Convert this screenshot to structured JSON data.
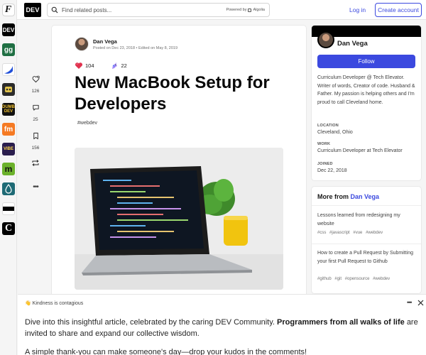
{
  "header": {
    "brand": "DEV",
    "search_placeholder": "Find related posts...",
    "powered_by": "Powered by",
    "powered_brand": "Algolia",
    "login_label": "Log in",
    "create_account_label": "Create account"
  },
  "rail": {
    "items": [
      {
        "name": "dev",
        "label": "DEV",
        "bg": "#000000"
      },
      {
        "name": "gg",
        "label": "gg",
        "bg": "#1f6f43"
      },
      {
        "name": "wave",
        "label": "",
        "bg": "#1f4ed8"
      },
      {
        "name": "robot",
        "label": "",
        "bg": "#2b2b2b"
      },
      {
        "name": "dumb-dev",
        "label": "DUMB DEV",
        "bg": "#111111"
      },
      {
        "name": "fm",
        "label": "fm",
        "bg": "#f57a23"
      },
      {
        "name": "vibe",
        "label": "VIBE",
        "bg": "#2a1d4d"
      },
      {
        "name": "m",
        "label": "m",
        "bg": "#6bb12b"
      },
      {
        "name": "drop",
        "label": "",
        "bg": "#1e6a75"
      },
      {
        "name": "bar",
        "label": "",
        "bg": "#ffffff"
      },
      {
        "name": "c",
        "label": "C",
        "bg": "#000000"
      }
    ]
  },
  "actions": {
    "likes": "126",
    "comments": "25",
    "saves": "156"
  },
  "article": {
    "author": "Dan Vega",
    "meta": "Posted on Dec 23, 2018 • Edited on May 8, 2019",
    "heart_count": "104",
    "unicorn_count": "22",
    "title": "New MacBook Setup for Developers",
    "tag": "#webdev"
  },
  "profile": {
    "name": "Dan Vega",
    "follow_label": "Follow",
    "bio": "Curriculum Developer @ Tech Elevator. Writer of words, Creator of code. Husband & Father. My passion is helping others and I'm proud to call Cleveland home.",
    "location_label": "LOCATION",
    "location": "Cleveland, Ohio",
    "work_label": "WORK",
    "work": "Curriculum Developer at Tech Elevator",
    "joined_label": "JOINED",
    "joined": "Dec 22, 2018"
  },
  "more_from": {
    "heading_prefix": "More from",
    "heading_author": "Dan Vega",
    "posts": [
      {
        "title": "Lessons learned from redesigning my website",
        "tags": [
          "#css",
          "#javascript",
          "#vue",
          "#webdev"
        ]
      },
      {
        "title": "How to create a Pull Request by Submitting your first Pull Request to Github",
        "tags": [
          "#github",
          "#git",
          "#opensource",
          "#webdev"
        ]
      }
    ]
  },
  "banner": {
    "heading": "👋 Kindness is contagious",
    "p1_start": "Dive into this insightful article, celebrated by the caring DEV Community.",
    "p1_bold": "Programmers from all walks of life",
    "p1_end": "are invited to share and expand our collective wisdom.",
    "p2": "A simple thank-you can make someone's day—drop your kudos in the comments!"
  }
}
